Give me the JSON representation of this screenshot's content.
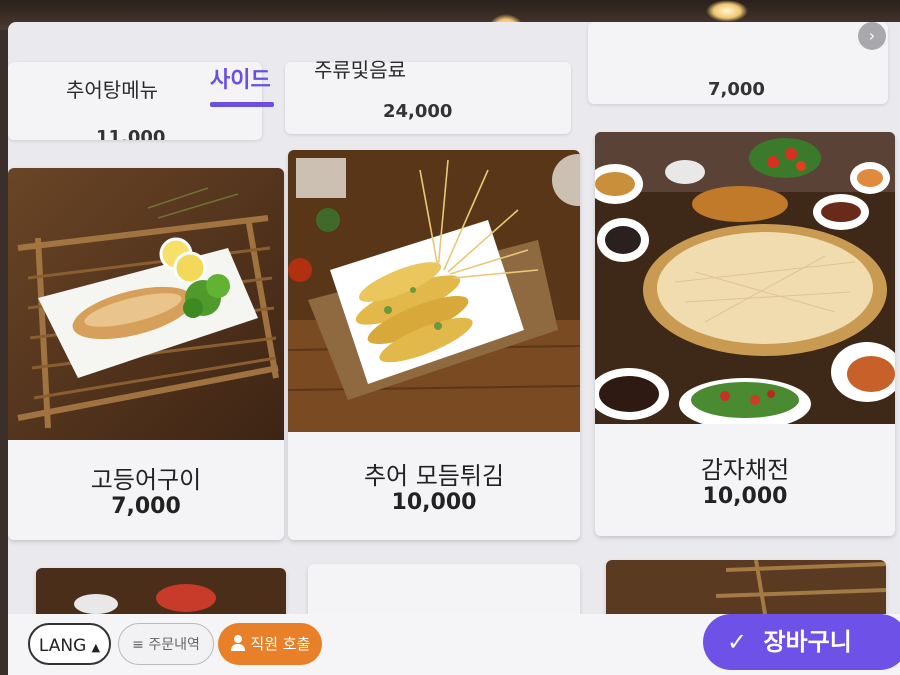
{
  "tabs": [
    {
      "label": "추어탕메뉴",
      "active": false
    },
    {
      "label": "사이드",
      "active": true
    },
    {
      "label": "주류및음료",
      "active": false
    }
  ],
  "top_row_prices": [
    "11,000",
    "24,000",
    "7,000"
  ],
  "menu_items": [
    {
      "name": "고등어구이",
      "price": "7,000"
    },
    {
      "name": "추어 모듬튀김",
      "price": "10,000"
    },
    {
      "name": "감자채전",
      "price": "10,000"
    }
  ],
  "bottom_bar": {
    "lang_label": "LANG",
    "lang_caret": "▲",
    "history_icon": "≡",
    "history_label": "주문내역",
    "staff_icon": "person-icon",
    "staff_label": "직원 호출",
    "cart_check": "✓",
    "cart_label": "장바구니"
  },
  "colors": {
    "accent": "#6b4fe0",
    "staff_call": "#e8802a",
    "cart": "#6e51e6"
  }
}
